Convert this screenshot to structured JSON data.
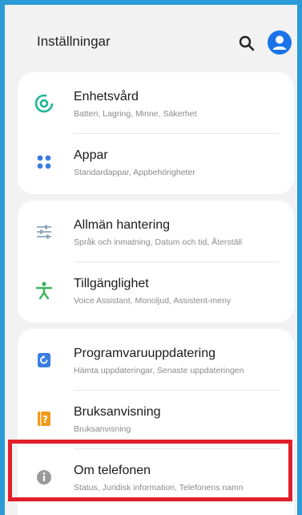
{
  "header": {
    "title": "Inställningar"
  },
  "icons": {
    "search": "search-icon",
    "profile": "profile-icon"
  },
  "groups": [
    {
      "items": [
        {
          "label": "Enhetsvård",
          "sub": "Batteri, Lagring, Minne, Säkerhet",
          "icon": "device-care-icon",
          "color": "#1fb594"
        },
        {
          "label": "Appar",
          "sub": "Standardappar, Appbehörigheter",
          "icon": "apps-icon",
          "color": "#3b7de0"
        }
      ]
    },
    {
      "items": [
        {
          "label": "Allmän hantering",
          "sub": "Språk och inmatning, Datum och tid, Återställ",
          "icon": "general-management-icon",
          "color": "#8aa7b8"
        },
        {
          "label": "Tillgänglighet",
          "sub": "Voice Assistant, Monoljud, Assistent-meny",
          "icon": "accessibility-icon",
          "color": "#3db35a"
        }
      ]
    },
    {
      "items": [
        {
          "label": "Programvaruuppdatering",
          "sub": "Hämta uppdateringar, Senaste uppdateringen",
          "icon": "software-update-icon",
          "color": "#3b7de0"
        },
        {
          "label": "Bruksanvisning",
          "sub": "Bruksanvisning",
          "icon": "user-manual-icon",
          "color": "#f29a1a"
        },
        {
          "label": "Om telefonen",
          "sub": "Status, Juridisk information, Telefonens namn",
          "icon": "about-phone-icon",
          "color": "#9a9a9a"
        }
      ]
    }
  ],
  "highlight_color": "#e0202a"
}
